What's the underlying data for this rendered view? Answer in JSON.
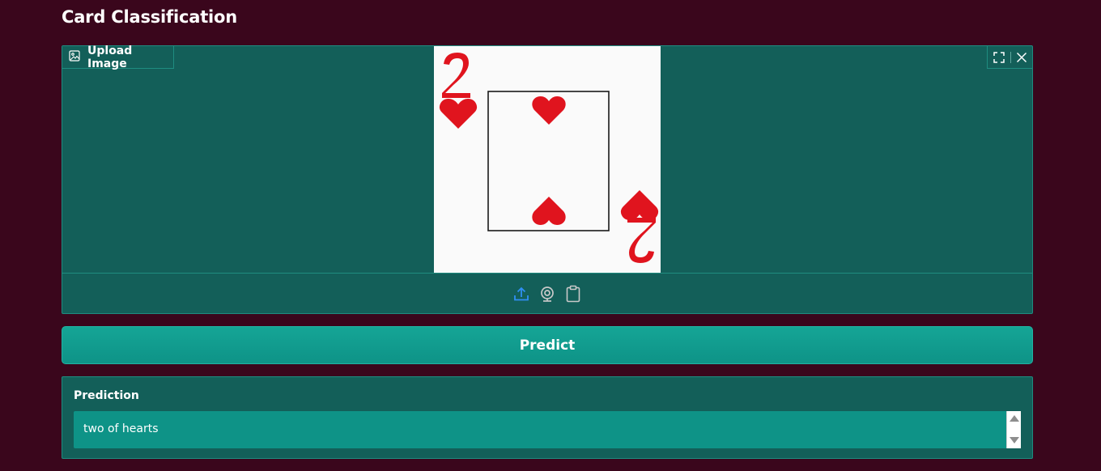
{
  "page": {
    "title": "Card Classification"
  },
  "image_input": {
    "label": "Upload Image",
    "label_icon": "image-icon",
    "corner_tools": [
      "fullscreen-icon",
      "close-icon"
    ],
    "card": {
      "rank": "2",
      "suit_symbol": "♥",
      "color": "#e0141e"
    },
    "sources": [
      "upload-icon",
      "webcam-icon",
      "clipboard-icon"
    ],
    "upload_color": "#2f8ff3"
  },
  "predict_button": {
    "label": "Predict"
  },
  "prediction": {
    "label": "Prediction",
    "value": "two of hearts"
  },
  "colors": {
    "background": "#3a061c",
    "panel": "#135f59",
    "accent": "#0e9387"
  }
}
